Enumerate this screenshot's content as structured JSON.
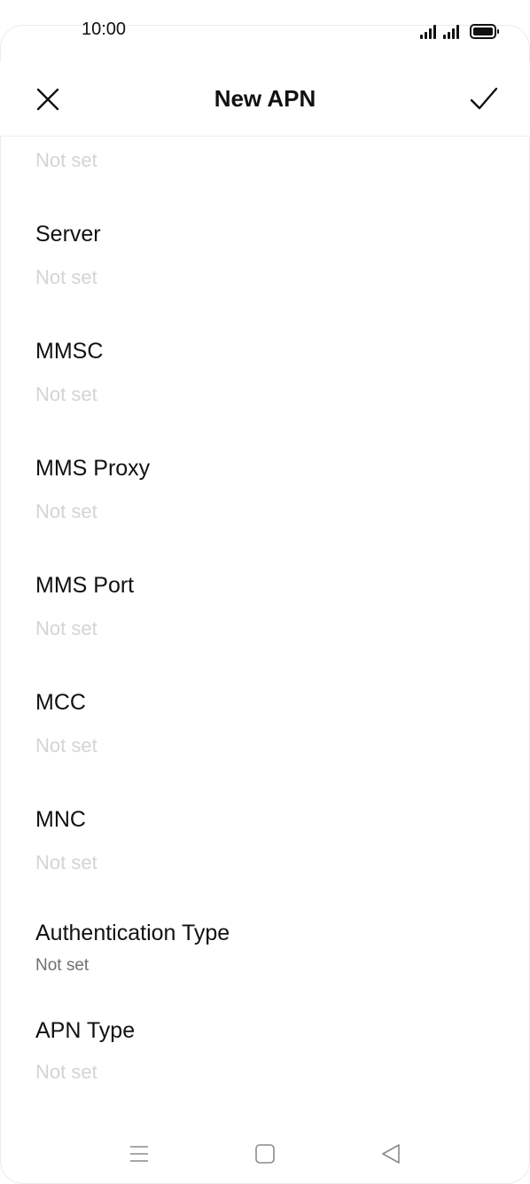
{
  "status_bar": {
    "time": "10:00",
    "icons": [
      "signal-1-icon",
      "signal-2-icon",
      "battery-icon"
    ]
  },
  "header": {
    "title": "New APN",
    "close_icon": "close-icon",
    "confirm_icon": "check-icon"
  },
  "fields": {
    "partial_value": "Not set",
    "items": [
      {
        "label": "Server",
        "value": "Not set"
      },
      {
        "label": "MMSC",
        "value": "Not set"
      },
      {
        "label": "MMS Proxy",
        "value": "Not set"
      },
      {
        "label": "MMS Port",
        "value": "Not set"
      },
      {
        "label": "MCC",
        "value": "Not set"
      },
      {
        "label": "MNC",
        "value": "Not set"
      },
      {
        "label": "Authentication Type",
        "value": "Not set"
      },
      {
        "label": "APN Type",
        "value": "Not set"
      }
    ]
  },
  "nav_bar": {
    "icons": [
      "menu-icon",
      "home-icon",
      "back-icon"
    ]
  },
  "colors": {
    "text": "#111111",
    "placeholder": "#d4d4d4",
    "value_set": "#6f6f6f",
    "divider": "#efefef"
  }
}
